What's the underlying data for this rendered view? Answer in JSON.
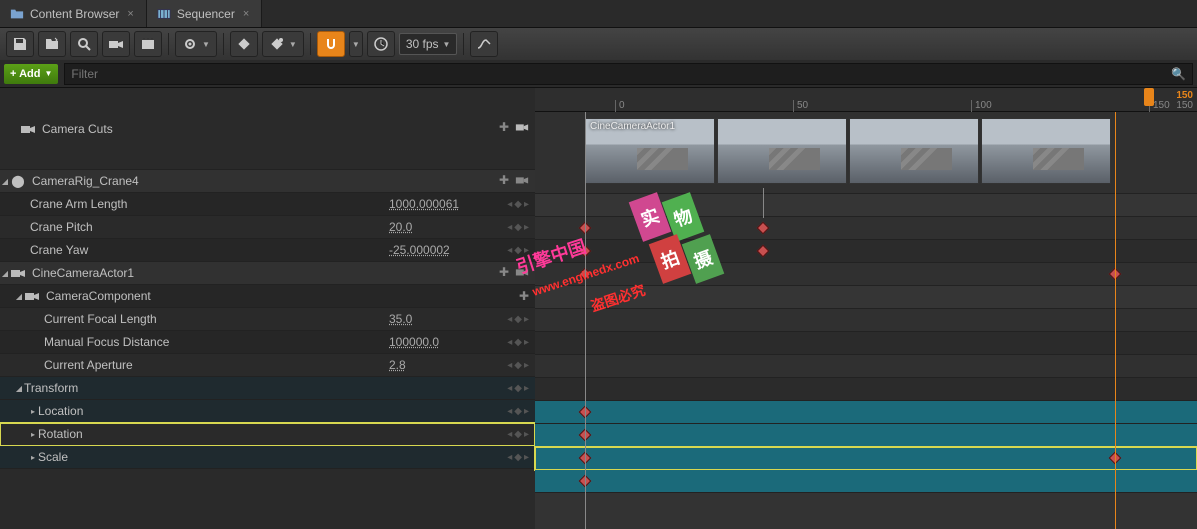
{
  "tabs": [
    {
      "label": "Content Browser",
      "active": false
    },
    {
      "label": "Sequencer",
      "active": true
    }
  ],
  "toolbar": {
    "fps_label": "30 fps"
  },
  "addrow": {
    "add_label": "+ Add",
    "filter_placeholder": "Filter"
  },
  "tracks": {
    "camera_cuts": "Camera Cuts",
    "rig": {
      "name": "CameraRig_Crane4",
      "arm_label": "Crane Arm Length",
      "arm_value": "1000.000061",
      "pitch_label": "Crane Pitch",
      "pitch_value": "20.0",
      "yaw_label": "Crane Yaw",
      "yaw_value": "-25.000002"
    },
    "camera": {
      "name": "CineCameraActor1",
      "comp": "CameraComponent",
      "focal_label": "Current Focal Length",
      "focal_value": "35.0",
      "focus_label": "Manual Focus Distance",
      "focus_value": "100000.0",
      "aperture_label": "Current Aperture",
      "aperture_value": "2.8",
      "transform": "Transform",
      "location": "Location",
      "rotation": "Rotation",
      "scale": "Scale"
    }
  },
  "timeline": {
    "thumb_label": "CineCameraActor1",
    "ticks": [
      "0",
      "50",
      "100",
      "150"
    ],
    "playhead_frame": "150"
  },
  "watermarks": {
    "a": "实",
    "b": "物",
    "c": "拍",
    "d": "摄",
    "e": "引擎中国",
    "f": "www.enginedx.com",
    "g": "盗图必究"
  }
}
